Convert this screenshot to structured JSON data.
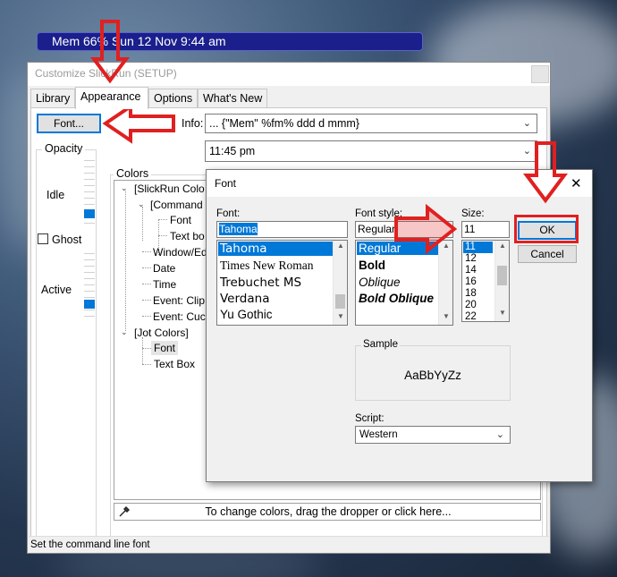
{
  "clock": {
    "text": "Mem 66% Sun 12 Nov  9:44 am"
  },
  "main_window": {
    "title": "Customize SlickRun (SETUP)",
    "tabs": [
      "Library",
      "Appearance",
      "Options",
      "What's New"
    ],
    "font_button": "Font...",
    "info_label": "Info:",
    "info_value": "... {\"Mem\" %fm% ddd d mmm}",
    "time_value": "11:45 pm",
    "opacity": {
      "label": "Opacity",
      "idle_label": "Idle",
      "active_label": "Active",
      "ghost_label": "Ghost"
    },
    "colors_label": "Colors",
    "tree": {
      "root1": "[SlickRun Colo",
      "command": "[Command",
      "font": "Font",
      "textbox": "Text bo",
      "window": "Window/Ed",
      "date": "Date",
      "time": "Time",
      "event_clip": "Event: Clip",
      "event_cuc": "Event: Cuc",
      "jot": "[Jot Colors]",
      "jot_font": "Font",
      "jot_textbox": "Text Box"
    },
    "dropper_hint": "To change colors, drag the dropper or click here...",
    "status_text": "Set the command line font"
  },
  "font_dialog": {
    "title": "Font",
    "font_label": "Font:",
    "font_value": "Tahoma",
    "fonts": [
      "Tahoma",
      "Times New Roman",
      "Trebuchet MS",
      "Verdana",
      "Yu Gothic"
    ],
    "style_label": "Font style:",
    "style_value": "Regular",
    "styles": [
      "Regular",
      "Bold",
      "Oblique",
      "Bold Oblique"
    ],
    "size_label": "Size:",
    "size_value": "11",
    "sizes": [
      "11",
      "12",
      "14",
      "16",
      "18",
      "20",
      "22"
    ],
    "ok": "OK",
    "cancel": "Cancel",
    "sample_label": "Sample",
    "sample_text": "AaBbYyZz",
    "script_label": "Script:",
    "script_value": "Western"
  },
  "annotations": {
    "arrow_color": "#e02020"
  }
}
